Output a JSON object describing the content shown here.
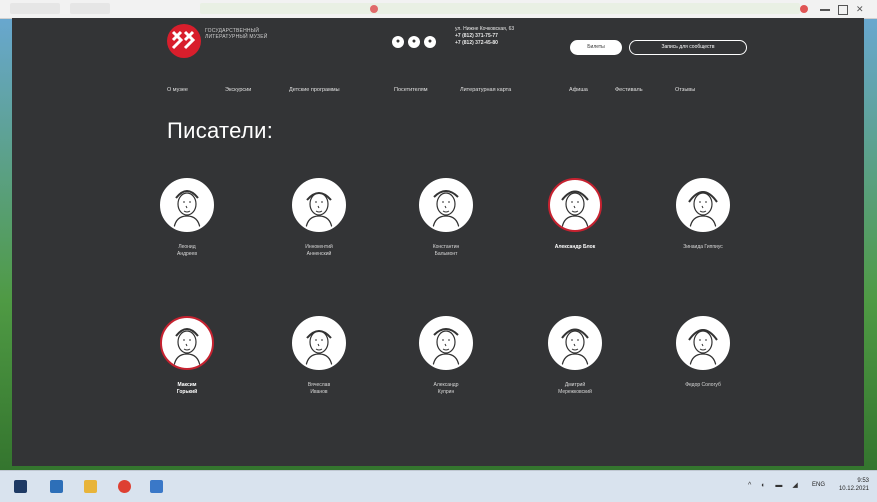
{
  "site": {
    "logo_text": "ГОСУДАРСТВЕННЫЙ ЛИТЕРАТУРНЫЙ МУЗЕЙ",
    "address": "ул. Нижне Кочковская, 63",
    "phone1": "+7 (812) 371-75-77",
    "phone2": "+7 (812) 372-45-80",
    "tickets_label": "Билеты",
    "subscription_label": "Запись для сообществ"
  },
  "nav": {
    "items": [
      "О музее",
      "Экскурсии",
      "Детские программы",
      "Посетителям",
      "Литературная карта",
      "Афиша",
      "Фестиваль",
      "Отзывы"
    ]
  },
  "page_title": "Писатели:",
  "writers": [
    {
      "name_line1": "Леонид",
      "name_line2": "Андреев",
      "active": false
    },
    {
      "name_line1": "Иннокентий",
      "name_line2": "Анненский",
      "active": false
    },
    {
      "name_line1": "Константин",
      "name_line2": "Бальмонт",
      "active": false
    },
    {
      "name_line1": "Александр Блок",
      "name_line2": "",
      "active": true
    },
    {
      "name_line1": "Зинаида Гиппиус",
      "name_line2": "",
      "active": false
    },
    {
      "name_line1": "Максим",
      "name_line2": "Горький",
      "active": true
    },
    {
      "name_line1": "Вячеслав",
      "name_line2": "Иванов",
      "active": false
    },
    {
      "name_line1": "Александр",
      "name_line2": "Куприн",
      "active": false
    },
    {
      "name_line1": "Дмитрий",
      "name_line2": "Мережковский",
      "active": false
    },
    {
      "name_line1": "Федор Сологуб",
      "name_line2": "",
      "active": false
    }
  ],
  "taskbar": {
    "lang": "ENG",
    "time": "9:53",
    "date": "10.12.2021"
  },
  "colors": {
    "accent": "#d81e2c",
    "page_bg": "#333436"
  }
}
